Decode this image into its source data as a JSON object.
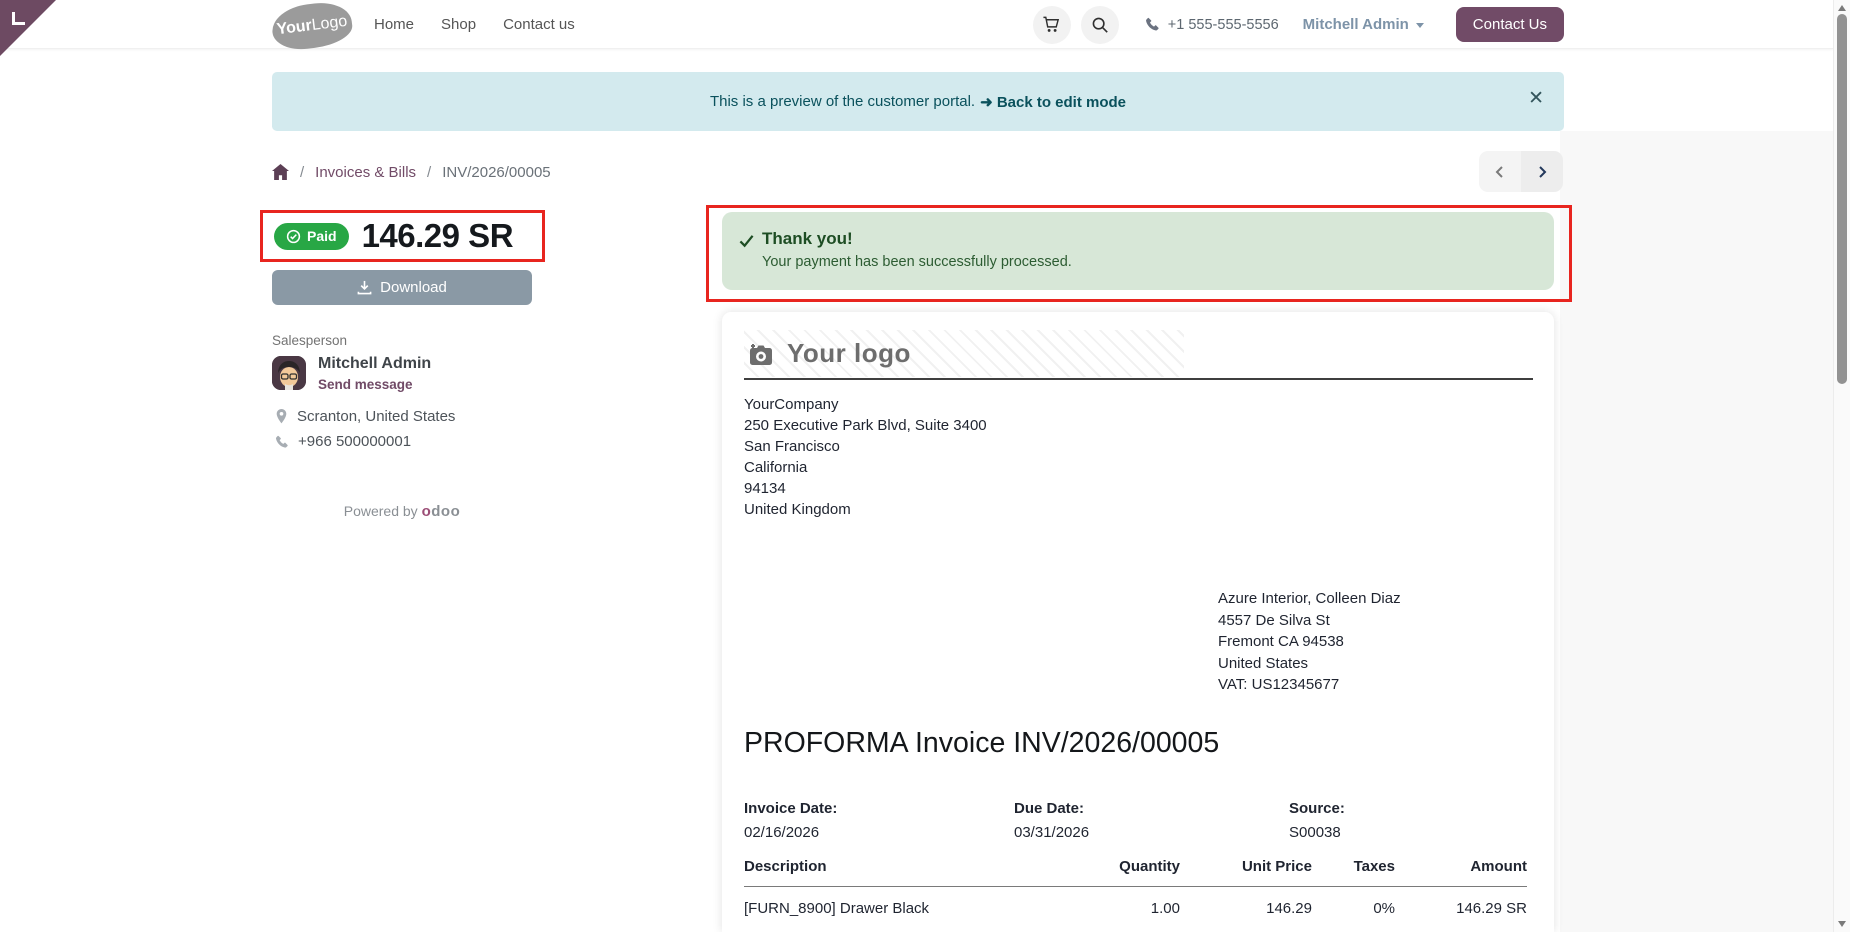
{
  "header": {
    "logo": {
      "bold": "Your",
      "light": "Logo"
    },
    "nav_items": [
      {
        "label": "Home"
      },
      {
        "label": "Shop"
      },
      {
        "label": "Contact us"
      }
    ],
    "phone": "+1 555-555-5556",
    "user_menu": "Mitchell Admin",
    "contact_button": "Contact Us"
  },
  "preview_banner": {
    "message": "This is a preview of the customer portal.",
    "action": "➜ Back to edit mode",
    "close": "✕"
  },
  "breadcrumb": {
    "separator": "/",
    "items": [
      {
        "label": "Invoices & Bills"
      },
      {
        "label": "INV/2026/00005"
      }
    ]
  },
  "payment_summary": {
    "status": "Paid",
    "amount": "146.29 SR",
    "download": "Download"
  },
  "salesperson": {
    "heading": "Salesperson",
    "name": "Mitchell Admin",
    "action": "Send message",
    "location": "Scranton, United States",
    "phone": "+966 500000001"
  },
  "footer": {
    "powered_by": "Powered by",
    "brand_first": "o",
    "brand_rest": "doo"
  },
  "payment_alert": {
    "title": "Thank you!",
    "message": "Your payment has been successfully processed."
  },
  "invoice_doc": {
    "logo_placeholder": "Your logo",
    "company_lines": [
      "YourCompany",
      "250 Executive Park Blvd, Suite 3400",
      "San Francisco",
      "California",
      "94134",
      "United Kingdom"
    ],
    "customer_lines": [
      "Azure Interior, Colleen Diaz",
      "4557 De Silva St",
      "Fremont CA 94538",
      "United States",
      "VAT: US12345677"
    ],
    "title": "PROFORMA Invoice INV/2026/00005",
    "meta": [
      {
        "label": "Invoice Date:",
        "value": "02/16/2026"
      },
      {
        "label": "Due Date:",
        "value": "03/31/2026"
      },
      {
        "label": "Source:",
        "value": "S00038"
      }
    ],
    "table": {
      "headers": [
        "Description",
        "Quantity",
        "Unit Price",
        "Taxes",
        "Amount"
      ],
      "rows": [
        {
          "description": "[FURN_8900] Drawer Black",
          "quantity": "1.00",
          "unit_price": "146.29",
          "taxes": "0%",
          "amount": "146.29 SR"
        }
      ]
    }
  },
  "colors": {
    "accent_purple": "#714B67",
    "success_green": "#28a745",
    "annotation_red": "#e8251f",
    "banner_bg": "#d3eaee",
    "banner_text": "#0a515c",
    "alert_bg": "#d7e7d7",
    "alert_text": "#1d4d23",
    "download_gray": "#8a99a5"
  }
}
